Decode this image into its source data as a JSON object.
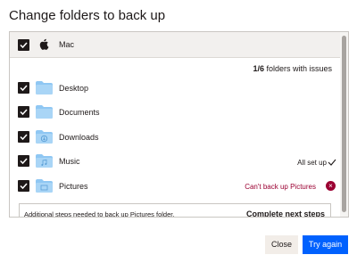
{
  "dialog": {
    "title": "Change folders to back up"
  },
  "device": {
    "name": "Mac",
    "icon": "apple-icon",
    "checked": true
  },
  "summary": {
    "count": "1/6",
    "text": " folders with issues"
  },
  "folders": [
    {
      "name": "Desktop",
      "icon": "folder-icon",
      "checked": true,
      "status": ""
    },
    {
      "name": "Documents",
      "icon": "folder-icon",
      "checked": true,
      "status": ""
    },
    {
      "name": "Downloads",
      "icon": "folder-download-icon",
      "checked": true,
      "status": ""
    },
    {
      "name": "Music",
      "icon": "folder-music-icon",
      "checked": true,
      "status": "All set up"
    },
    {
      "name": "Pictures",
      "icon": "folder-picture-icon",
      "checked": true,
      "status": "Can't back up Pictures"
    }
  ],
  "error_icon_glyph": "×",
  "notice": {
    "text": "Additional steps needed to back up Pictures folder.",
    "link": "Complete next steps"
  },
  "buttons": {
    "close": "Close",
    "try_again": "Try again"
  },
  "colors": {
    "accent": "#0061fe",
    "error": "#9b0032",
    "folder": "#8fc7f3"
  }
}
